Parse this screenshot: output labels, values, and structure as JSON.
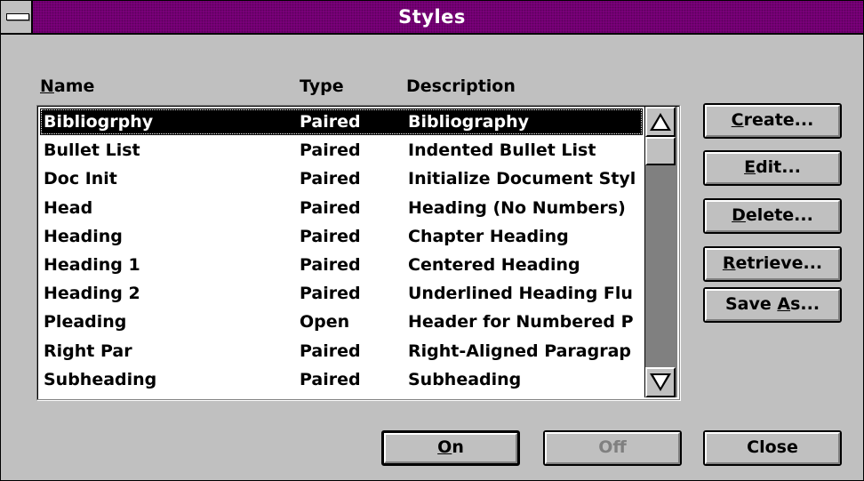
{
  "window": {
    "title": "Styles"
  },
  "columns": {
    "name": {
      "mnemonic": "N",
      "rest": "ame"
    },
    "type": "Type",
    "description": "Description"
  },
  "styles": [
    {
      "name": "Bibliogrphy",
      "type": "Paired",
      "description": "Bibliography",
      "selected": true
    },
    {
      "name": "Bullet List",
      "type": "Paired",
      "description": "Indented Bullet List"
    },
    {
      "name": "Doc Init",
      "type": "Paired",
      "description": "Initialize Document Styl"
    },
    {
      "name": "Head",
      "type": "Paired",
      "description": "Heading (No Numbers)"
    },
    {
      "name": "Heading",
      "type": "Paired",
      "description": "Chapter Heading"
    },
    {
      "name": "Heading 1",
      "type": "Paired",
      "description": "Centered Heading"
    },
    {
      "name": "Heading 2",
      "type": "Paired",
      "description": "Underlined Heading Flu"
    },
    {
      "name": "Pleading",
      "type": "Open",
      "description": "Header for Numbered P"
    },
    {
      "name": "Right Par",
      "type": "Paired",
      "description": "Right-Aligned Paragrap"
    },
    {
      "name": "Subheading",
      "type": "Paired",
      "description": "Subheading"
    }
  ],
  "buttons": {
    "create": {
      "mnemonic": "C",
      "rest": "reate..."
    },
    "edit": {
      "mnemonic": "E",
      "rest": "dit..."
    },
    "delete": {
      "mnemonic": "D",
      "rest": "elete..."
    },
    "retrieve": {
      "mnemonic": "R",
      "rest": "etrieve..."
    },
    "save_as": {
      "pre": "Save ",
      "mnemonic": "A",
      "rest": "s..."
    },
    "on": {
      "mnemonic": "O",
      "rest": "n"
    },
    "off": {
      "label": "Off"
    },
    "close": {
      "label": "Close"
    }
  },
  "scrollbar": {
    "position": 0.0
  },
  "colors": {
    "titlebar": "#800080",
    "face": "#c0c0c0",
    "selection": "#000000",
    "disabled_text": "#808080"
  },
  "icons": {
    "system_menu": "system-menu-icon",
    "scroll_up": "up-arrow-icon",
    "scroll_down": "down-arrow-icon"
  }
}
